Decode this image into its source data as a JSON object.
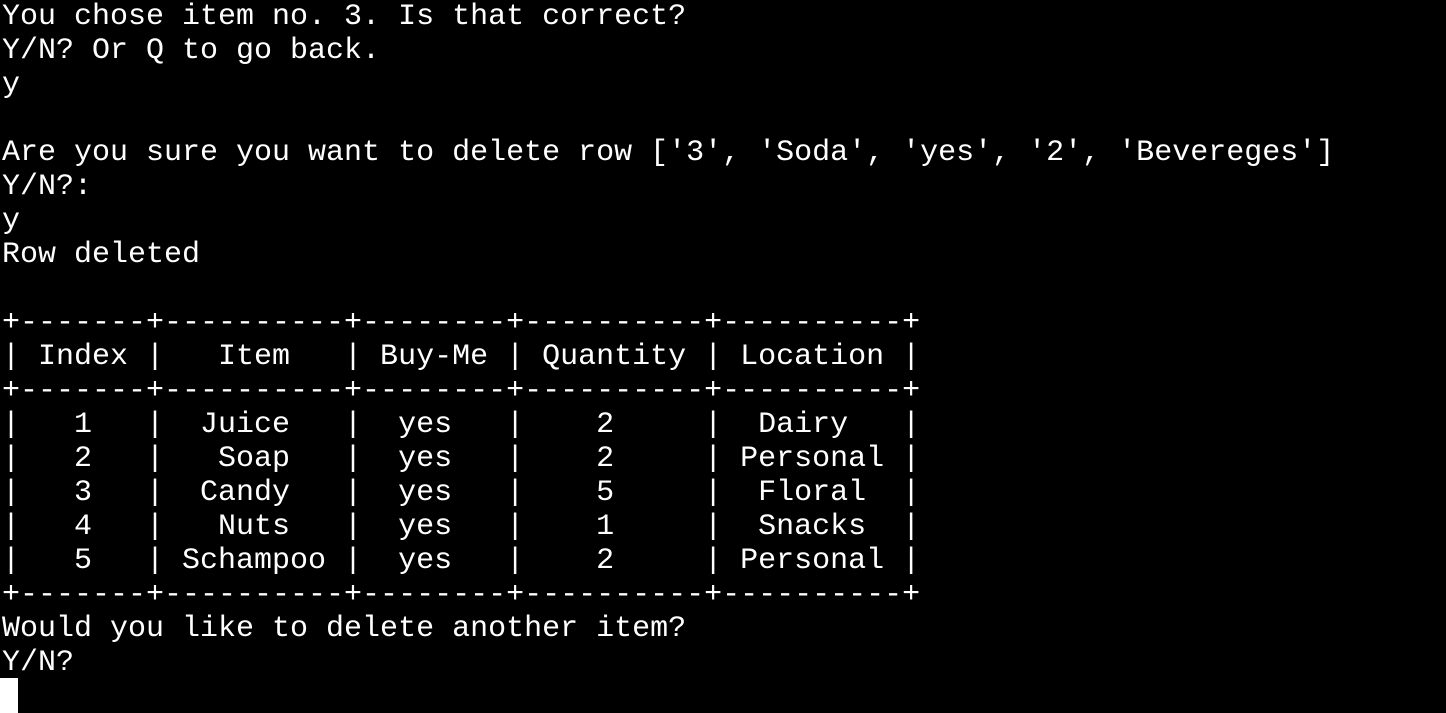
{
  "terminal": {
    "background": "#000000",
    "foreground": "#ffffff",
    "lines": [
      "You chose item no. 3. Is that correct?",
      "Y/N? Or Q to go back.",
      "y",
      "",
      "Are you sure you want to delete row ['3', 'Soda', 'yes', '2', 'Bevereges']",
      "Y/N?:",
      "y",
      "Row deleted",
      "",
      "+-------+----------+--------+----------+----------+",
      "| Index |   Item   | Buy-Me | Quantity | Location |",
      "+-------+----------+--------+----------+----------+",
      "|   1   |  Juice   |  yes   |    2     |  Dairy   |",
      "|   2   |   Soap   |  yes   |    2     | Personal |",
      "|   3   |  Candy   |  yes   |    5     |  Floral  |",
      "|   4   |   Nuts   |  yes   |    1     |  Snacks  |",
      "|   5   | Schampoo |  yes   |    2     | Personal |",
      "+-------+----------+--------+----------+----------+",
      "Would you like to delete another item?",
      "Y/N?"
    ]
  }
}
